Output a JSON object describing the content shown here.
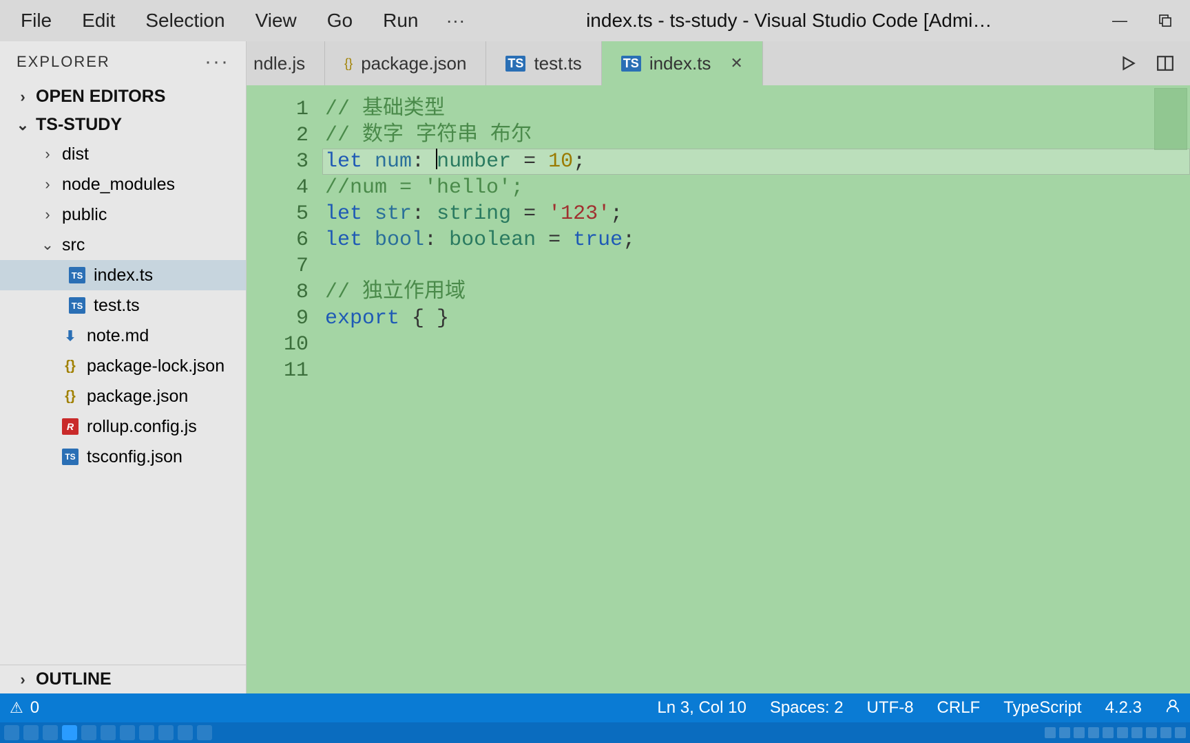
{
  "menu": {
    "items": [
      "File",
      "Edit",
      "Selection",
      "View",
      "Go",
      "Run"
    ],
    "ellipsis": "···"
  },
  "title": "index.ts - ts-study - Visual Studio Code [Admi…",
  "explorer": {
    "header": "EXPLORER",
    "open_editors": "OPEN EDITORS",
    "project": "TS-STUDY",
    "outline": "OUTLINE",
    "tree": [
      {
        "kind": "folder",
        "name": "dist",
        "expanded": false,
        "depth": 1
      },
      {
        "kind": "folder",
        "name": "node_modules",
        "expanded": false,
        "depth": 1
      },
      {
        "kind": "folder",
        "name": "public",
        "expanded": false,
        "depth": 1
      },
      {
        "kind": "folder",
        "name": "src",
        "expanded": true,
        "depth": 1
      },
      {
        "kind": "file",
        "name": "index.ts",
        "icon": "ts",
        "depth": 2,
        "selected": true
      },
      {
        "kind": "file",
        "name": "test.ts",
        "icon": "ts",
        "depth": 2
      },
      {
        "kind": "file",
        "name": "note.md",
        "icon": "md",
        "depth": 1
      },
      {
        "kind": "file",
        "name": "package-lock.json",
        "icon": "braces",
        "depth": 1
      },
      {
        "kind": "file",
        "name": "package.json",
        "icon": "braces",
        "depth": 1
      },
      {
        "kind": "file",
        "name": "rollup.config.js",
        "icon": "r",
        "depth": 1
      },
      {
        "kind": "file",
        "name": "tsconfig.json",
        "icon": "tsconfig",
        "depth": 1
      }
    ]
  },
  "tabs": [
    {
      "label": "ndle.js",
      "icon": "",
      "partial": true
    },
    {
      "label": "package.json",
      "icon": "{}"
    },
    {
      "label": "test.ts",
      "icon": "TS"
    },
    {
      "label": "index.ts",
      "icon": "TS",
      "active": true,
      "closable": true
    }
  ],
  "code": {
    "lines": [
      {
        "n": 1,
        "t": "// 基础类型",
        "cls": "c"
      },
      {
        "n": 2,
        "t": "// 数字 字符串 布尔",
        "cls": "c"
      },
      {
        "n": 3,
        "current": true,
        "caret_before": "number",
        "tokens": [
          [
            "kw",
            "let "
          ],
          [
            "var",
            "num"
          ],
          [
            "",
            ":"
          ],
          [
            "",
            " "
          ],
          [
            "type",
            "number"
          ],
          [
            "",
            " = "
          ],
          [
            "num",
            "10"
          ],
          [
            "",
            ";"
          ]
        ]
      },
      {
        "n": 4,
        "t": "//num = 'hello';",
        "cls": "c"
      },
      {
        "n": 5,
        "tokens": [
          [
            "kw",
            "let "
          ],
          [
            "var",
            "str"
          ],
          [
            "",
            ":"
          ],
          [
            "",
            " "
          ],
          [
            "type",
            "string"
          ],
          [
            "",
            " = "
          ],
          [
            "str",
            "'123'"
          ],
          [
            "",
            ";"
          ]
        ]
      },
      {
        "n": 6,
        "tokens": [
          [
            "kw",
            "let "
          ],
          [
            "var",
            "bool"
          ],
          [
            "",
            ":"
          ],
          [
            "",
            " "
          ],
          [
            "type",
            "boolean"
          ],
          [
            "",
            " = "
          ],
          [
            "bool",
            "true"
          ],
          [
            "",
            ";"
          ]
        ]
      },
      {
        "n": 7,
        "t": "",
        "cls": ""
      },
      {
        "n": 8,
        "t": "// 独立作用域",
        "cls": "c"
      },
      {
        "n": 9,
        "tokens": [
          [
            "exp",
            "export "
          ],
          [
            "",
            "{ }"
          ]
        ]
      },
      {
        "n": 10,
        "t": "",
        "cls": ""
      },
      {
        "n": 11,
        "t": "",
        "cls": ""
      }
    ]
  },
  "status": {
    "problems": "0",
    "pos": "Ln 3, Col 10",
    "spaces": "Spaces: 2",
    "encoding": "UTF-8",
    "eol": "CRLF",
    "lang": "TypeScript",
    "ver": "4.2.3"
  }
}
